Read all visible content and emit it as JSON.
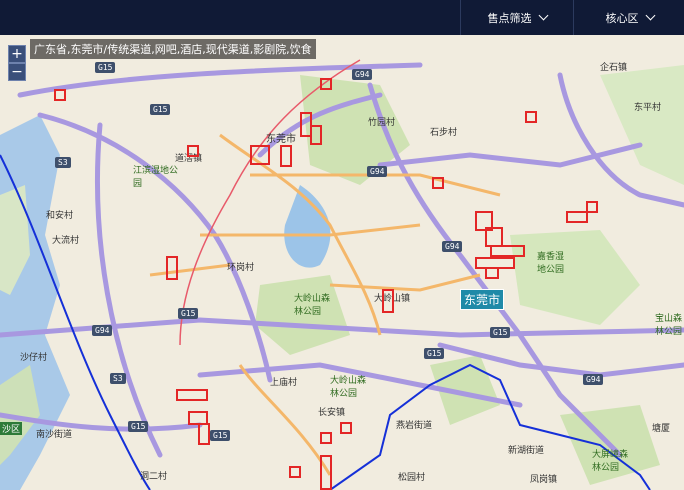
{
  "header": {
    "filter_label": "售点筛选",
    "region_label": "核心区",
    "background": "#101a36"
  },
  "map": {
    "title": "广东省,东莞市/传统渠道,网吧,酒店,现代渠道,影剧院,饮食",
    "zoom_in": "+",
    "zoom_out": "−",
    "city_label": "东莞市",
    "highlight_color": "#e32626",
    "place_labels": [
      "竹园村",
      "石步村",
      "企石镇",
      "东平村",
      "东莞市",
      "江滨湿地公园",
      "道滘镇",
      "和安村",
      "大流村",
      "环岗村",
      "大岭山森林公园",
      "大岭山镇",
      "嘉香湿地公园",
      "宝山森林公园",
      "沙仔村",
      "上庙村",
      "大岭山森林公园",
      "长安镇",
      "燕岩街道",
      "新湖街道",
      "南沙街道",
      "大屏嶂森林公园",
      "塘厦",
      "洞二村",
      "凤岗镇",
      "松园村",
      "沙区"
    ],
    "road_labels": [
      "G15",
      "G94",
      "S3",
      "G15",
      "G94",
      "G94",
      "G15",
      "G15",
      "G15",
      "G94",
      "S3",
      "G15",
      "G94",
      "G15"
    ]
  }
}
